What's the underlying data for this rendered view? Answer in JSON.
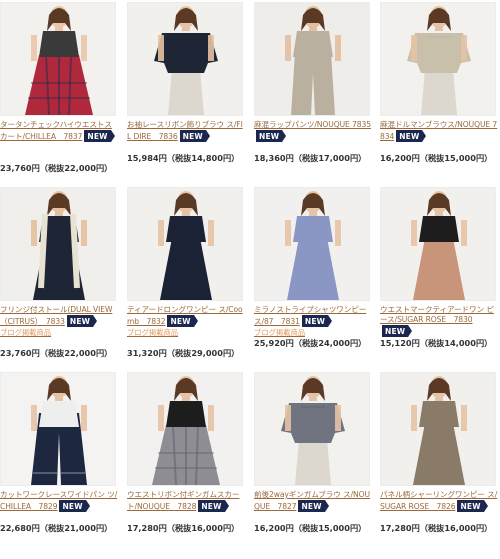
{
  "badge_new": "NEW",
  "products": [
    {
      "name": "タータンチェックハイウエストス カート/CHILLEA　7837",
      "new": true,
      "blog": "",
      "price": "23,760円（税抜22,000円）",
      "colors": {
        "bg": "#f3f1ee",
        "main": "#b0283b",
        "accent": "#1d2c55",
        "top": "#3a3a3a",
        "skin": "#e9c7a8"
      }
    },
    {
      "name": "お袖レースリボン飾りブラウ ス/FIL DIRE　7836",
      "new": true,
      "blog": "",
      "price": "15,984円（税抜14,800円）",
      "colors": {
        "bg": "#f2f0ec",
        "main": "#1e2535",
        "accent": "#1e2535",
        "top": "#1e2535",
        "skin": "#e6c3a4"
      }
    },
    {
      "name": "麻混ラップパンツ/NOUQUE 7835",
      "new": true,
      "blog": "",
      "price": "18,360円（税抜17,000円）",
      "colors": {
        "bg": "#efede9",
        "main": "#b9b09f",
        "accent": "#9f977f",
        "top": "#b9b09f",
        "skin": "#e2bea0"
      }
    },
    {
      "name": "麻混ドルマンブラウス/NOUQUE 7834",
      "new": true,
      "blog": "",
      "price": "16,200円（税抜15,000円）",
      "colors": {
        "bg": "#f2f1ee",
        "main": "#c9c0ac",
        "accent": "#b4ab97",
        "top": "#c9c0ac",
        "skin": "#e6c3a4"
      }
    },
    {
      "name": "フリンジ付ストール(DUAL VIEW（CITRUS）　7833",
      "new": true,
      "blog": "ブログ掲載商品",
      "price": "23,760円（税抜22,000円）",
      "colors": {
        "bg": "#f1efec",
        "main": "#1e2535",
        "accent": "#e8e2d2",
        "top": "#1e2535",
        "skin": "#e4c0a0"
      }
    },
    {
      "name": "ティアードロングワンピー ス/Coomb　7832",
      "new": true,
      "blog": "ブログ掲載商品",
      "price": "31,320円（税抜29,000円）",
      "colors": {
        "bg": "#f2f0ed",
        "main": "#1b2236",
        "accent": "#1b2236",
        "top": "#1b2236",
        "skin": "#e6c3a4"
      }
    },
    {
      "name": "ミラノストライプシャツワンピー ス/87　7831",
      "new": true,
      "blog": "ブログ掲載商品",
      "price": "25,920円（税抜24,000円）",
      "colors": {
        "bg": "#f1f0ee",
        "main": "#8a96c4",
        "accent": "#6f7bb0",
        "top": "#8a96c4",
        "skin": "#e6c3a4"
      }
    },
    {
      "name": "ウエストマークティアードワン ピース/SUGAR ROSE　7830",
      "new": true,
      "blog": "",
      "price": "15,120円（税抜14,000円）",
      "colors": {
        "bg": "#f2f0ed",
        "main": "#c8957b",
        "accent": "#1d1d1d",
        "top": "#1d1d1d",
        "skin": "#e6c3a4"
      }
    },
    {
      "name": "カットワークレースワイドパン ツ/CHILLEA　7829",
      "new": true,
      "blog": "",
      "price": "22,680円（税抜21,000円）",
      "colors": {
        "bg": "#f4f3f1",
        "main": "#1e2740",
        "accent": "#1e2740",
        "top": "#eeeeee",
        "skin": "#e6c3a4"
      }
    },
    {
      "name": "ウエストリボン付ギンガムスカー ト/NOUQUE　7828",
      "new": true,
      "blog": "",
      "price": "17,280円（税抜16,000円）",
      "colors": {
        "bg": "#f2f1ef",
        "main": "#8d8d93",
        "accent": "#5d5d66",
        "top": "#1d1d1d",
        "skin": "#e6c3a4"
      }
    },
    {
      "name": "前後2wayギンガムブラウ ス/NOUQUE　7827",
      "new": true,
      "blog": "",
      "price": "16,200円（税抜15,000円）",
      "colors": {
        "bg": "#f3f1ee",
        "main": "#707480",
        "accent": "#4f535e",
        "top": "#707480",
        "skin": "#e6c3a4"
      }
    },
    {
      "name": "パネル柄シャーリングワンピー ス/SUGAR ROSE　7826",
      "new": true,
      "blog": "",
      "price": "17,280円（税抜16,000円）",
      "colors": {
        "bg": "#f2f0ed",
        "main": "#8a7a68",
        "accent": "#3c3a48",
        "top": "#8a7a68",
        "skin": "#e6c3a4"
      }
    }
  ]
}
